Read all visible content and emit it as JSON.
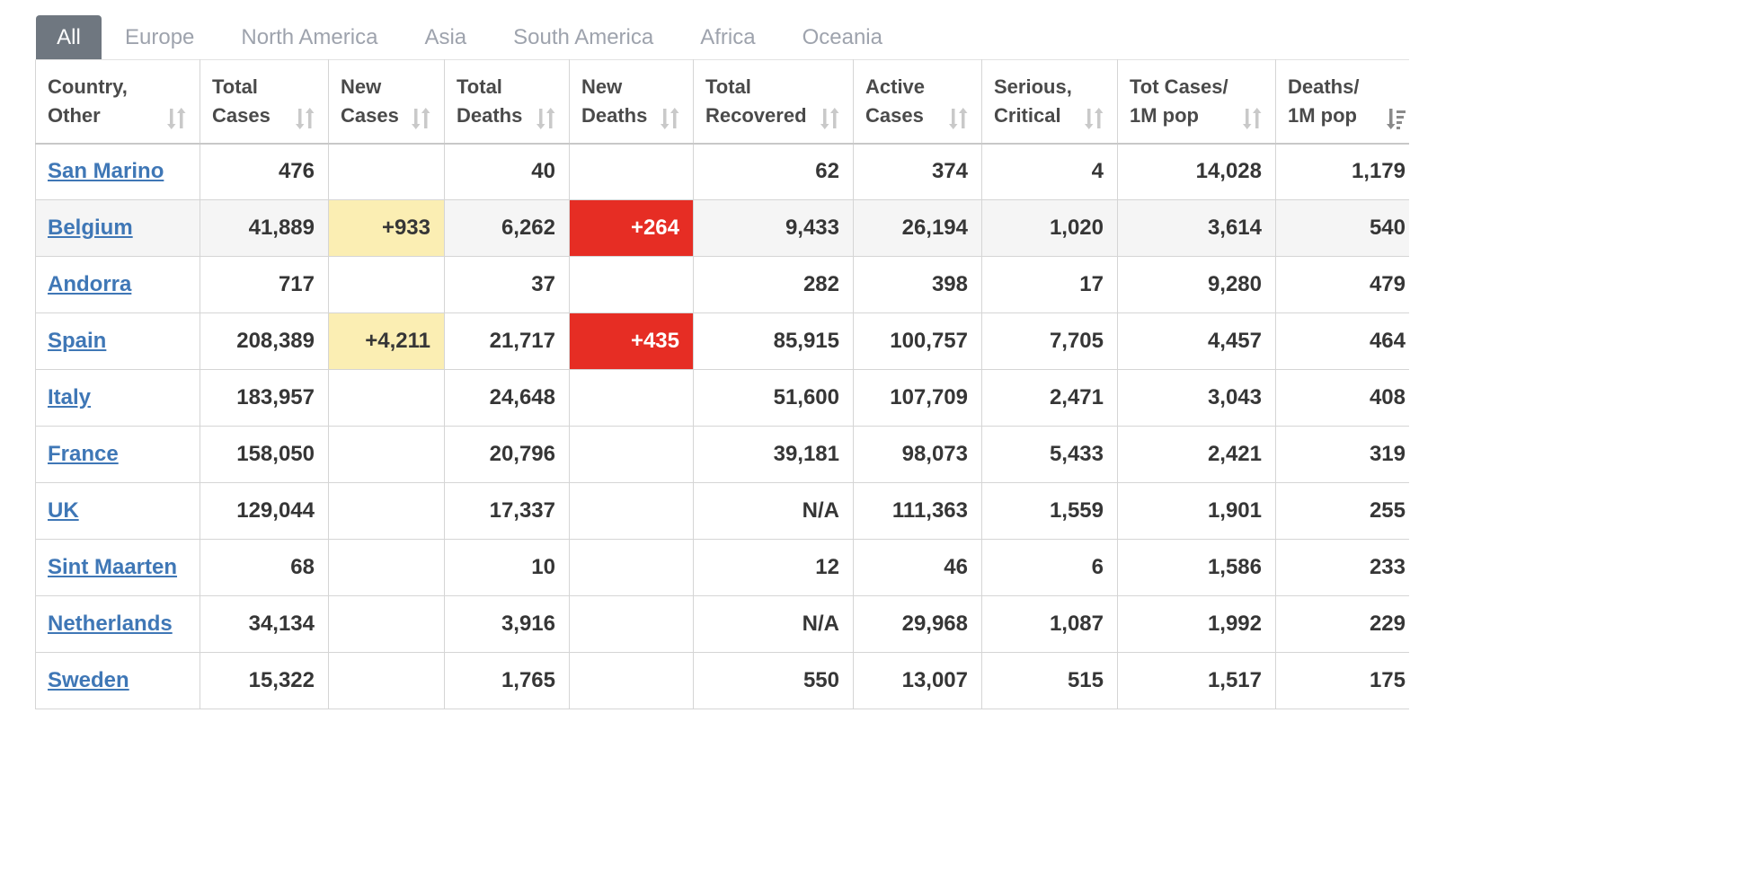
{
  "tabs": [
    {
      "label": "All",
      "active": true
    },
    {
      "label": "Europe",
      "active": false
    },
    {
      "label": "North America",
      "active": false
    },
    {
      "label": "Asia",
      "active": false
    },
    {
      "label": "South America",
      "active": false
    },
    {
      "label": "Africa",
      "active": false
    },
    {
      "label": "Oceania",
      "active": false
    }
  ],
  "columns": [
    {
      "line1": "Country,",
      "line2": "Other"
    },
    {
      "line1": "Total",
      "line2": "Cases"
    },
    {
      "line1": "New",
      "line2": "Cases"
    },
    {
      "line1": "Total",
      "line2": "Deaths"
    },
    {
      "line1": "New",
      "line2": "Deaths"
    },
    {
      "line1": "Total",
      "line2": "Recovered"
    },
    {
      "line1": "Active",
      "line2": "Cases"
    },
    {
      "line1": "Serious,",
      "line2": "Critical"
    },
    {
      "line1": "Tot Cases/",
      "line2": "1M pop"
    },
    {
      "line1": "Deaths/",
      "line2": "1M pop"
    }
  ],
  "sorted_column": "Deaths/ 1M pop",
  "sort_direction": "descending",
  "colors": {
    "tab_active_bg": "#6f7780",
    "tab_text": "#9ea3ad",
    "link": "#3f77b6",
    "new_cases_highlight": "#fbeeb3",
    "new_deaths_highlight": "#e62d24",
    "alt_row": "#f5f5f5"
  },
  "rows": [
    {
      "country": "San Marino",
      "total_cases": "476",
      "new_cases": "",
      "total_deaths": "40",
      "new_deaths": "",
      "total_recovered": "62",
      "active_cases": "374",
      "serious_critical": "4",
      "tot_cases_1m": "14,028",
      "deaths_1m": "1,179"
    },
    {
      "country": "Belgium",
      "total_cases": "41,889",
      "new_cases": "+933",
      "total_deaths": "6,262",
      "new_deaths": "+264",
      "total_recovered": "9,433",
      "active_cases": "26,194",
      "serious_critical": "1,020",
      "tot_cases_1m": "3,614",
      "deaths_1m": "540"
    },
    {
      "country": "Andorra",
      "total_cases": "717",
      "new_cases": "",
      "total_deaths": "37",
      "new_deaths": "",
      "total_recovered": "282",
      "active_cases": "398",
      "serious_critical": "17",
      "tot_cases_1m": "9,280",
      "deaths_1m": "479"
    },
    {
      "country": "Spain",
      "total_cases": "208,389",
      "new_cases": "+4,211",
      "total_deaths": "21,717",
      "new_deaths": "+435",
      "total_recovered": "85,915",
      "active_cases": "100,757",
      "serious_critical": "7,705",
      "tot_cases_1m": "4,457",
      "deaths_1m": "464"
    },
    {
      "country": "Italy",
      "total_cases": "183,957",
      "new_cases": "",
      "total_deaths": "24,648",
      "new_deaths": "",
      "total_recovered": "51,600",
      "active_cases": "107,709",
      "serious_critical": "2,471",
      "tot_cases_1m": "3,043",
      "deaths_1m": "408"
    },
    {
      "country": "France",
      "total_cases": "158,050",
      "new_cases": "",
      "total_deaths": "20,796",
      "new_deaths": "",
      "total_recovered": "39,181",
      "active_cases": "98,073",
      "serious_critical": "5,433",
      "tot_cases_1m": "2,421",
      "deaths_1m": "319"
    },
    {
      "country": "UK",
      "total_cases": "129,044",
      "new_cases": "",
      "total_deaths": "17,337",
      "new_deaths": "",
      "total_recovered": "N/A",
      "active_cases": "111,363",
      "serious_critical": "1,559",
      "tot_cases_1m": "1,901",
      "deaths_1m": "255"
    },
    {
      "country": "Sint Maarten",
      "total_cases": "68",
      "new_cases": "",
      "total_deaths": "10",
      "new_deaths": "",
      "total_recovered": "12",
      "active_cases": "46",
      "serious_critical": "6",
      "tot_cases_1m": "1,586",
      "deaths_1m": "233"
    },
    {
      "country": "Netherlands",
      "total_cases": "34,134",
      "new_cases": "",
      "total_deaths": "3,916",
      "new_deaths": "",
      "total_recovered": "N/A",
      "active_cases": "29,968",
      "serious_critical": "1,087",
      "tot_cases_1m": "1,992",
      "deaths_1m": "229"
    },
    {
      "country": "Sweden",
      "total_cases": "15,322",
      "new_cases": "",
      "total_deaths": "1,765",
      "new_deaths": "",
      "total_recovered": "550",
      "active_cases": "13,007",
      "serious_critical": "515",
      "tot_cases_1m": "1,517",
      "deaths_1m": "175"
    }
  ]
}
